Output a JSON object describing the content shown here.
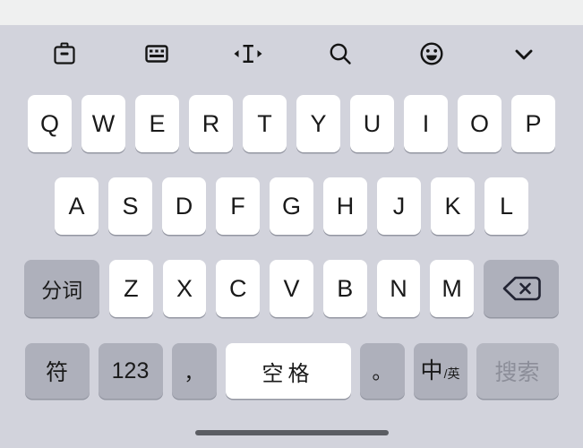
{
  "toolbar": {
    "items": [
      {
        "icon": "clipboard-icon",
        "label": "剪贴板"
      },
      {
        "icon": "keyboard-icon",
        "label": "键盘设置"
      },
      {
        "icon": "cursor-move-icon",
        "label": "移动光标"
      },
      {
        "icon": "search-icon",
        "label": "搜索"
      },
      {
        "icon": "emoji-icon",
        "label": "表情"
      },
      {
        "icon": "chevron-down-icon",
        "label": "收起键盘"
      }
    ]
  },
  "keyboard": {
    "row1": [
      "Q",
      "W",
      "E",
      "R",
      "T",
      "Y",
      "U",
      "I",
      "O",
      "P"
    ],
    "row2": [
      "A",
      "S",
      "D",
      "F",
      "G",
      "H",
      "J",
      "K",
      "L"
    ],
    "row3": {
      "segment_label": "分词",
      "letters": [
        "Z",
        "X",
        "C",
        "V",
        "B",
        "N",
        "M"
      ],
      "backspace_label": "删除"
    },
    "row4": {
      "symbol_label": "符",
      "numeric_label": "123",
      "comma_label": "，",
      "space_label": "空格",
      "period_label": "。",
      "lang_main": "中",
      "lang_sep": "/",
      "lang_sub": "英",
      "enter_label": "搜索"
    }
  },
  "colors": {
    "keyboard_bg": "#d2d3dc",
    "light_key": "#ffffff",
    "dark_key": "#aeb0bb",
    "muted_key": "#b5b7c1",
    "muted_text": "#8c8e99",
    "key_text": "#1a1a1a",
    "app_bg": "#eff0f0",
    "home_bar": "#5b5d63"
  }
}
